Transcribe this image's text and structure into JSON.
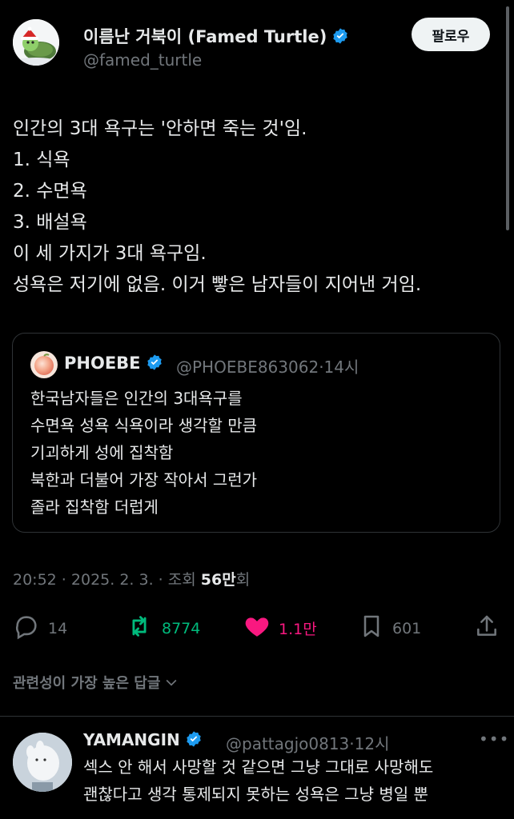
{
  "post": {
    "author_name": "이름난 거북이 (Famed Turtle)",
    "author_handle": "@famed_turtle",
    "follow_label": "팔로우",
    "lines": [
      "인간의 3대 욕구는 '안하면 죽는 것'임.",
      "1. 식욕",
      "2. 수면욕",
      "3. 배설욕",
      "이 세 가지가 3대 욕구임.",
      "성욕은 저기에 없음. 이거 빻은 남자들이 지어낸 거임."
    ]
  },
  "quote": {
    "author_name": "PHOEBE",
    "author_handle": "@PHOEBE863062",
    "separator": "·",
    "time": "14시",
    "lines": [
      "한국남자들은 인간의 3대욕구를",
      "수면욕 성욕 식욕이라 생각할 만큼",
      "기괴하게 성에 집착함",
      "북한과 더불어 가장 작아서 그런가",
      "졸라 집착함 더럽게"
    ]
  },
  "meta": {
    "time": "20:52",
    "date": "2025. 2. 3.",
    "views_label": "조회",
    "views_value": "56만",
    "views_suffix": "회"
  },
  "actions": {
    "replies": "14",
    "reposts": "8774",
    "likes": "1.1만",
    "bookmarks": "601"
  },
  "sort": {
    "label": "관련성이 가장 높은 답글"
  },
  "reply": {
    "author_name": "YAMANGIN",
    "author_handle": "@pattagjo0813",
    "time": "12시",
    "lines": [
      "섹스 안 해서 사망할 것 같으면 그냥 그대로 사망해도",
      "괜찮다고 생각 통제되지 못하는 성욕은 그냥 병일 뿐"
    ]
  },
  "colors": {
    "background": "#000000",
    "text": "#e7e9ea",
    "muted": "#71767b",
    "verified": "#1d9bf0",
    "repost_active": "#00ba7c",
    "like_active": "#f91880",
    "border": "#2f3336"
  }
}
